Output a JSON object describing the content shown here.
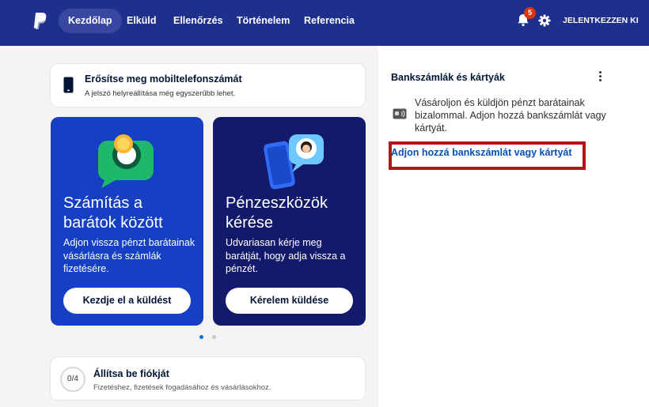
{
  "nav": {
    "items": [
      {
        "label": "Kezdőlap",
        "active": true
      },
      {
        "label": "Elküld"
      },
      {
        "label": "Ellenőrzés"
      },
      {
        "label": "Történelem"
      },
      {
        "label": "Referencia"
      }
    ],
    "notification_count": "5",
    "logout_label": "JELENTKEZZEN KI",
    "icons": [
      "paypal-logo",
      "bell-icon",
      "gear-icon"
    ],
    "colors": {
      "bar": "#1e2f8c",
      "active_pill": "#3947a0",
      "badge": "#d9360b"
    }
  },
  "verify": {
    "title": "Erősítse meg mobiltelefonszámát",
    "subtitle": "A jelszó helyreállítása még egyszerűbb lehet."
  },
  "promos": [
    {
      "title": "Számítás a barátok között",
      "description": "Adjon vissza pénzt barátainak vásárlásra és számlák fizetésére.",
      "button": "Kezdje el a küldést",
      "color": "#1540c4"
    },
    {
      "title": "Pénzeszközök kérése",
      "description": "Udvariasan kérje meg barátját, hogy adja vissza a pénzét.",
      "button": "Kérelem küldése",
      "color": "#141a6b"
    }
  ],
  "carousel": {
    "page_count": 2,
    "active_index": 0
  },
  "setup": {
    "progress": "0/4",
    "title": "Állítsa be fiókját",
    "subtitle": "Fizetéshez, fizetések fogadásához és vásárlásokhoz."
  },
  "bank_panel": {
    "title": "Bankszámlák és kártyák",
    "description": "Vásároljon és küldjön pénzt barátainak bizalommal. Adjon hozzá bankszámlát vagy kártyát.",
    "link": "Adjon hozzá bankszámlát vagy kártyát",
    "link_color": "#0551b5",
    "highlight_color": "#b0161a"
  }
}
